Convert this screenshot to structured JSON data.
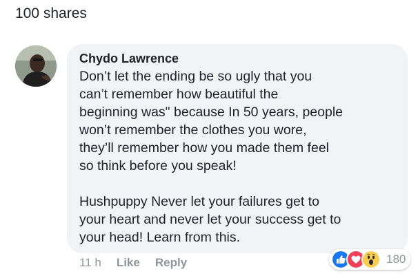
{
  "shares_text": "100 shares",
  "comment": {
    "author": "Chydo Lawrence",
    "text_lines": [
      "Don’t let the ending be so ugly that you",
      "can’t remember how beautiful the",
      "beginning was\" because In 50 years, people",
      "won’t remember the clothes you wore,",
      "they’ll remember how you made them feel",
      "so think before you speak!",
      "",
      "Hushpuppy Never let your failures get to",
      "your heart and never let your success get to",
      "your head! Learn from this."
    ],
    "time": "11 h",
    "like_label": "Like",
    "reply_label": "Reply",
    "reactions": {
      "icons": [
        "like-icon",
        "love-icon",
        "wow-icon"
      ],
      "count": "180"
    }
  },
  "colors": {
    "bubble": "#f2f3f5",
    "meta_text": "#90949c",
    "like_blue": "#1877f2",
    "love_red": "#f33e58",
    "wow_yellow": "#fbcd4b"
  }
}
